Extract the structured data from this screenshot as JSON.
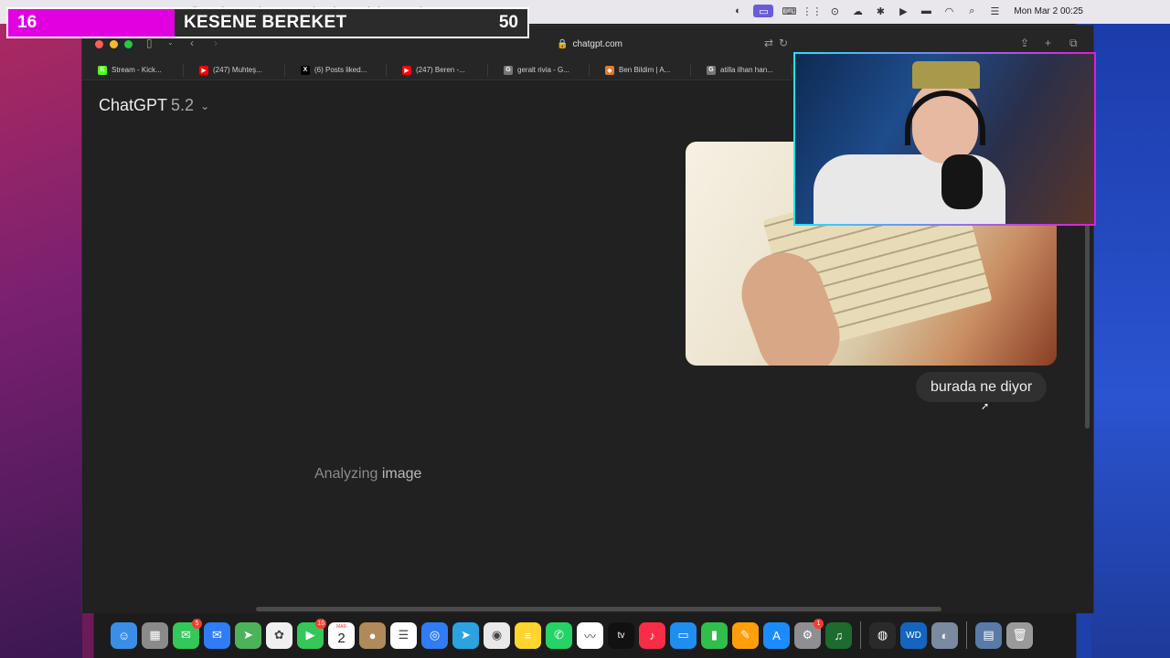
{
  "overlay": {
    "count": "16",
    "title": "KESENE BEREKET",
    "goal": "50",
    "progress_fraction": 0.32
  },
  "menubar": {
    "menus": [
      "Edit",
      "View",
      "History",
      "Bookmarks",
      "Window",
      "Help"
    ],
    "clock": "Mon Mar 2  00:25"
  },
  "browser": {
    "url": "chatgpt.com",
    "bookmarks": [
      {
        "label": "Stream - Kick...",
        "icon": "kick-icon",
        "color": "#53fc18",
        "glyph": "K"
      },
      {
        "label": "(247) Muhteş...",
        "icon": "youtube-icon",
        "color": "#ff0000",
        "glyph": "▶"
      },
      {
        "label": "(6) Posts liked...",
        "icon": "x-icon",
        "color": "#000000",
        "glyph": "X"
      },
      {
        "label": "(247) Beren -...",
        "icon": "youtube-icon",
        "color": "#ff0000",
        "glyph": "▶"
      },
      {
        "label": "geralt rivia - G...",
        "icon": "google-icon",
        "color": "#777777",
        "glyph": "G"
      },
      {
        "label": "Ben Bildim | A...",
        "icon": "bookmark-icon",
        "color": "#e07a2a",
        "glyph": "◆"
      },
      {
        "label": "atilla ilhan han...",
        "icon": "google-icon",
        "color": "#777777",
        "glyph": "G"
      }
    ]
  },
  "chat": {
    "model_name": "ChatGPT",
    "model_version": "5.2",
    "user_message": "burada ne diyor",
    "status_word1": "Analyzing",
    "status_word2": "image"
  },
  "dock": {
    "apps": [
      {
        "name": "finder",
        "bg": "#3a8ee6",
        "glyph": "☺"
      },
      {
        "name": "launchpad",
        "bg": "#8a8a8a",
        "glyph": "▦"
      },
      {
        "name": "messages",
        "bg": "#34c759",
        "glyph": "✉",
        "badge": "5"
      },
      {
        "name": "mail",
        "bg": "#2f7cf6",
        "glyph": "✉"
      },
      {
        "name": "maps",
        "bg": "#4cb35b",
        "glyph": "➤"
      },
      {
        "name": "photos",
        "bg": "#f0f0f0",
        "glyph": "✿"
      },
      {
        "name": "facetime",
        "bg": "#34c759",
        "glyph": "▶",
        "badge": "16"
      },
      {
        "name": "calendar",
        "bg": "#ffffff",
        "glyph": "2",
        "top": "MAR"
      },
      {
        "name": "contacts",
        "bg": "#b08a5a",
        "glyph": "●"
      },
      {
        "name": "reminders",
        "bg": "#ffffff",
        "glyph": "☰"
      },
      {
        "name": "safari",
        "bg": "#2f7cf6",
        "glyph": "◎"
      },
      {
        "name": "telegram",
        "bg": "#2aa3e0",
        "glyph": "➤"
      },
      {
        "name": "chrome",
        "bg": "#e9e9e9",
        "glyph": "◉"
      },
      {
        "name": "notes",
        "bg": "#ffd52e",
        "glyph": "≡"
      },
      {
        "name": "whatsapp",
        "bg": "#25d366",
        "glyph": "✆"
      },
      {
        "name": "freeform",
        "bg": "#ffffff",
        "glyph": "〰"
      },
      {
        "name": "apple-tv",
        "bg": "#111111",
        "glyph": "tv"
      },
      {
        "name": "music",
        "bg": "#fa2d48",
        "glyph": "♪"
      },
      {
        "name": "keynote",
        "bg": "#1f8ef1",
        "glyph": "▭"
      },
      {
        "name": "numbers",
        "bg": "#2fbf4a",
        "glyph": "▮"
      },
      {
        "name": "pages",
        "bg": "#ff9f0a",
        "glyph": "✎"
      },
      {
        "name": "app-store",
        "bg": "#1a8cff",
        "glyph": "A"
      },
      {
        "name": "system-settings",
        "bg": "#8e8e93",
        "glyph": "⚙",
        "badge": "1"
      },
      {
        "name": "guitar-app",
        "bg": "#1d6b2e",
        "glyph": "♫"
      },
      {
        "name": "obs",
        "bg": "#2a2a2a",
        "glyph": "◍"
      },
      {
        "name": "wd-discovery",
        "bg": "#1565c0",
        "glyph": "WD"
      },
      {
        "name": "preview",
        "bg": "#7a8aa0",
        "glyph": "◐"
      },
      {
        "name": "downloads-stack",
        "bg": "#5a7aa8",
        "glyph": "▤"
      },
      {
        "name": "trash",
        "bg": "#9a9a9a",
        "glyph": "🗑"
      }
    ]
  }
}
